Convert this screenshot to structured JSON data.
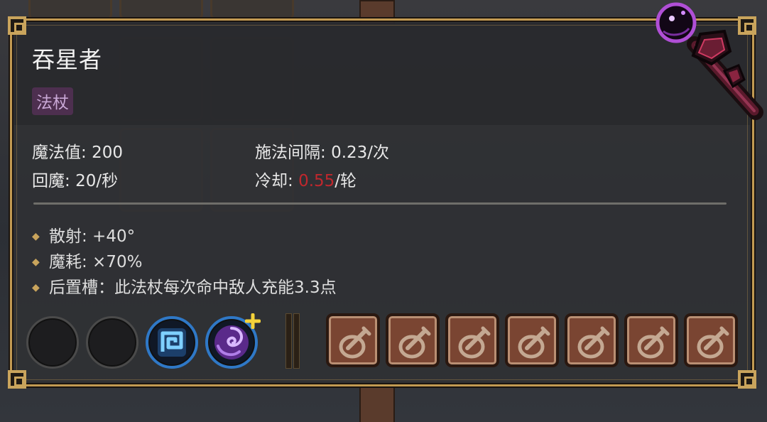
{
  "item": {
    "name": "吞星者",
    "type_tag": "法杖"
  },
  "stats": {
    "mana_label": "魔法值: ",
    "mana_value": "200",
    "regen_label": "回魔: ",
    "regen_value": "20/秒",
    "interval_label": "施法间隔: ",
    "interval_value": "0.23/次",
    "cooldown_label": "冷却: ",
    "cooldown_value": "0.55",
    "cooldown_unit": "/轮"
  },
  "effects": [
    {
      "text": "散射: +40°"
    },
    {
      "text": "魔耗: ×70%"
    },
    {
      "text": "后置槽：此法杖每次命中敌人充能3.3点"
    }
  ],
  "slots": {
    "front": [
      {
        "state": "empty"
      },
      {
        "state": "empty"
      },
      {
        "state": "gem",
        "icon": "spiral-rune-icon"
      },
      {
        "state": "gem",
        "icon": "vortex-orb-icon",
        "badge": "plus"
      }
    ],
    "back": [
      {
        "icon": "locked-slot-icon"
      },
      {
        "icon": "locked-slot-icon"
      },
      {
        "icon": "locked-slot-icon"
      },
      {
        "icon": "locked-slot-icon"
      },
      {
        "icon": "locked-slot-icon"
      },
      {
        "icon": "locked-slot-icon"
      },
      {
        "icon": "locked-slot-icon"
      }
    ]
  },
  "colors": {
    "frame_gold": "#c29a52",
    "highlight_red": "#c0272d",
    "tag_purple": "#4d2f4f",
    "gem_blue": "#2f78c6",
    "slot_brown": "#7a4532"
  }
}
